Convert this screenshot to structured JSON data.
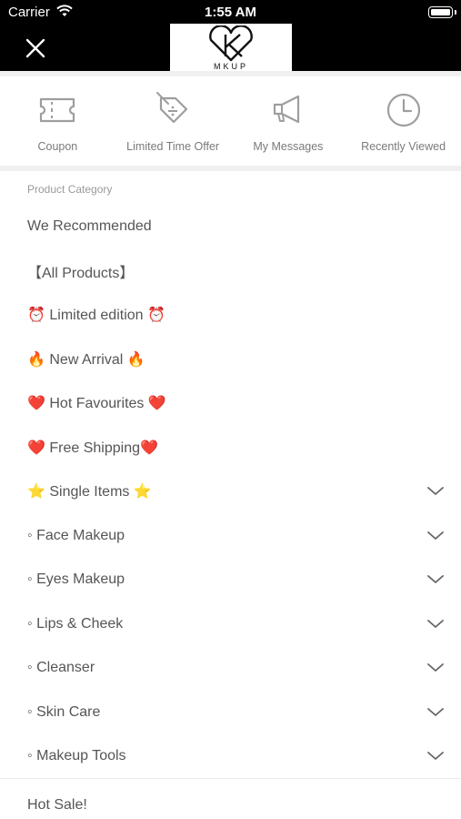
{
  "status_bar": {
    "carrier": "Carrier",
    "time": "1:55 AM"
  },
  "header": {
    "logo_text": "MKUP"
  },
  "quick_links": [
    {
      "label": "Coupon",
      "icon": "coupon-ticket-icon"
    },
    {
      "label": "Limited Time Offer",
      "icon": "discount-tag-icon"
    },
    {
      "label": "My Messages",
      "icon": "megaphone-icon"
    },
    {
      "label": "Recently Viewed",
      "icon": "clock-icon"
    }
  ],
  "category": {
    "heading": "Product Category",
    "items": [
      {
        "label": "We Recommended",
        "expandable": false
      },
      {
        "label": "【All Products】",
        "expandable": false
      },
      {
        "label": "⏰ Limited edition ⏰",
        "expandable": false
      },
      {
        "label": "🔥 New Arrival 🔥",
        "expandable": false
      },
      {
        "label": "❤️ Hot Favourites ❤️",
        "expandable": false
      },
      {
        "label": "❤️ Free Shipping❤️",
        "expandable": false
      },
      {
        "label": "⭐ Single Items ⭐",
        "expandable": true
      },
      {
        "label": "◦ Face Makeup",
        "expandable": true
      },
      {
        "label": "◦ Eyes Makeup",
        "expandable": true
      },
      {
        "label": "◦ Lips & Cheek",
        "expandable": true
      },
      {
        "label": "◦ Cleanser",
        "expandable": true
      },
      {
        "label": "◦ Skin Care",
        "expandable": true
      },
      {
        "label": "◦ Makeup Tools",
        "expandable": true
      }
    ]
  },
  "hot_sale": "Hot Sale!",
  "colors": {
    "header_bg": "#000000",
    "icon_gray": "#9e9e9e",
    "text_gray": "#555555"
  }
}
